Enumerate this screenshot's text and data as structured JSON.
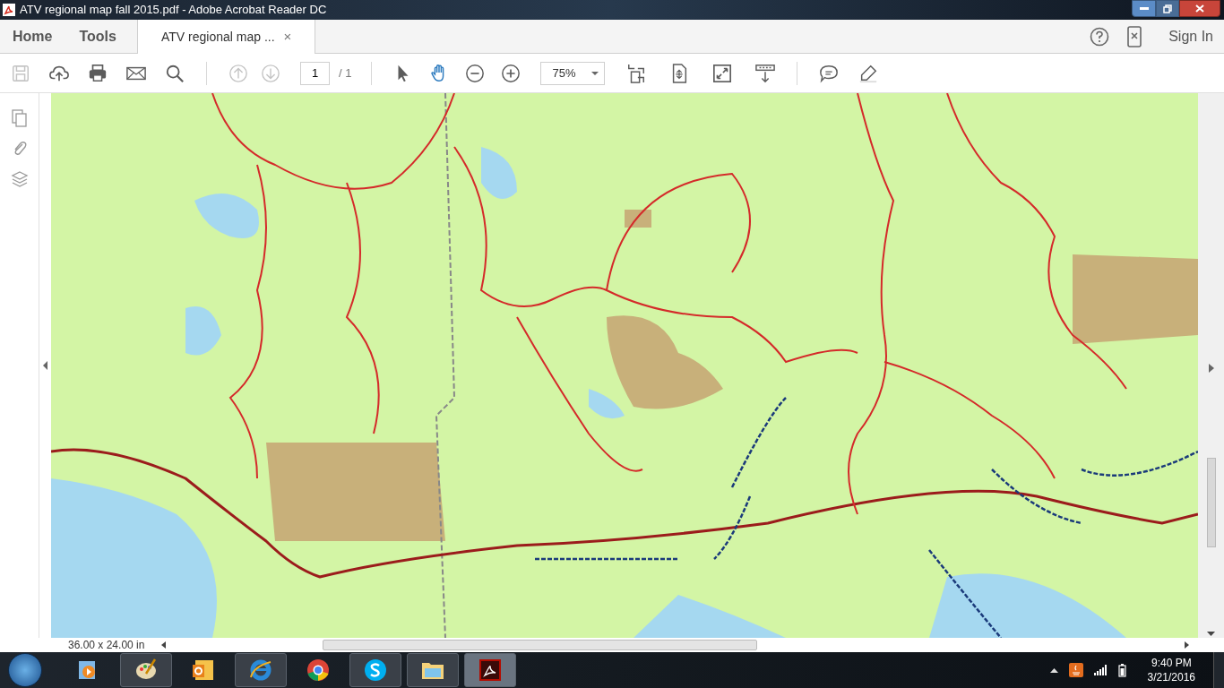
{
  "window": {
    "title": "ATV regional  map fall 2015.pdf - Adobe Acrobat Reader DC"
  },
  "nav": [
    {
      "label": "Home"
    },
    {
      "label": "Tools"
    }
  ],
  "document_tab": {
    "label": "ATV regional  map ...",
    "close": "×",
    "selected": true
  },
  "account": {
    "sign_in": "Sign In"
  },
  "toolbar": {
    "left_tools": [
      {
        "kind": "save",
        "disabled": true
      },
      {
        "kind": "upload",
        "disabled": false
      },
      {
        "kind": "print",
        "disabled": false
      },
      {
        "kind": "mail",
        "disabled": false
      },
      {
        "kind": "search",
        "disabled": false
      }
    ],
    "page_nav": [
      {
        "kind": "prev",
        "disabled": true
      },
      {
        "kind": "next",
        "disabled": true
      }
    ],
    "page": "1",
    "page_total": "/ 1",
    "mode_tools": [
      {
        "kind": "select",
        "selected": false
      },
      {
        "kind": "hand",
        "selected": true
      },
      {
        "kind": "zoom-out",
        "selected": false
      },
      {
        "kind": "zoom-in",
        "selected": false
      }
    ],
    "zoom": "75%",
    "view_tools": [
      {
        "kind": "fit"
      },
      {
        "kind": "scroll"
      },
      {
        "kind": "fullscreen"
      },
      {
        "kind": "download"
      }
    ],
    "comment_tools": [
      {
        "kind": "comment"
      },
      {
        "kind": "highlight"
      }
    ]
  },
  "status_bar": {
    "page_size": "36.00 x 24.00 in"
  },
  "taskbar": {
    "apps": [
      {
        "kind": "media",
        "running": false
      },
      {
        "kind": "paint",
        "running": true
      },
      {
        "kind": "outlook",
        "running": false
      },
      {
        "kind": "ie",
        "running": true
      },
      {
        "kind": "chrome",
        "running": false
      },
      {
        "kind": "skype",
        "running": true
      },
      {
        "kind": "explorer",
        "running": true
      },
      {
        "kind": "acrobat",
        "running": true,
        "selected": true
      }
    ],
    "time": "9:40 PM",
    "date": "3/21/2016"
  }
}
